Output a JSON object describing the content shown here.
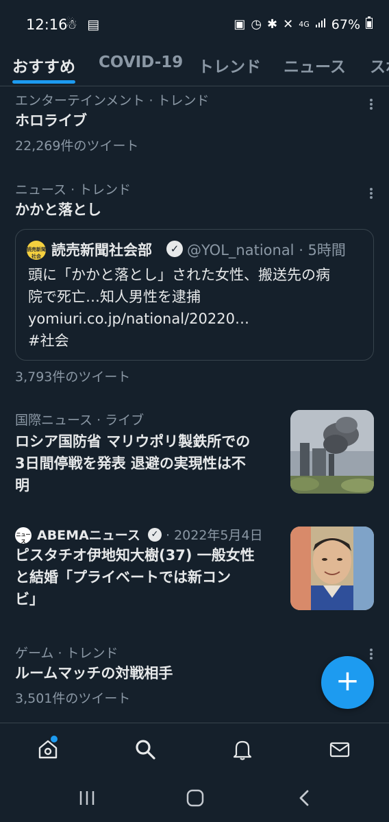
{
  "status_bar": {
    "time": "12:16",
    "left_icons": "☃ ▤",
    "battery": "67%",
    "network": "4G"
  },
  "tabs": [
    {
      "label": "おすすめ",
      "active": true
    },
    {
      "label": "COVID-19",
      "active": false
    },
    {
      "label": "トレンド",
      "active": false
    },
    {
      "label": "ニュース",
      "active": false
    },
    {
      "label": "スポ",
      "active": false
    }
  ],
  "feed": {
    "trend1": {
      "meta": "エンターテインメント · トレンド",
      "title": "ホロライブ",
      "count": "22,269件のツイート"
    },
    "trend2": {
      "meta": "ニュース · トレンド",
      "title": "かかと落とし",
      "quote": {
        "avatar_text": "読売新聞 社会",
        "author": "読売新聞社会部",
        "handle": "@YOL_national · 5時間",
        "line1": "頭に「かかと落とし」された女性、搬送先の病",
        "line2": "院で死亡…知人男性を逮捕",
        "line3": "yomiuri.co.jp/national/20220…",
        "line4": "#社会"
      },
      "count": "3,793件のツイート"
    },
    "news1": {
      "meta_cat": "国際ニュース",
      "meta_live": " · ライブ",
      "title_line1": "ロシア国防省 マリウポリ製鉄所での",
      "title_line2": "3日間停戦を発表 退避の実現性は不",
      "title_line3": "明"
    },
    "news2": {
      "avatar_text": "ニュース",
      "source": "ABEMAニュース",
      "date": "· 2022年5月4日",
      "title_line1": "ピスタチオ伊地知大樹(37) 一般女性",
      "title_line2": "と結婚「プライベートでは新コン",
      "title_line3": "ビ」"
    },
    "trend3": {
      "meta": "ゲーム · トレンド",
      "title": "ルームマッチの対戦相手",
      "count": "3,501件のツイート"
    }
  },
  "fab": {
    "label": "+"
  },
  "bottom_nav": [
    "home-icon",
    "search-icon",
    "notifications-icon",
    "messages-icon"
  ],
  "colors": {
    "background": "#15202b",
    "accent": "#1d9bf0",
    "text": "#e7e9ea",
    "muted": "#8b98a5",
    "border": "#38444d"
  }
}
